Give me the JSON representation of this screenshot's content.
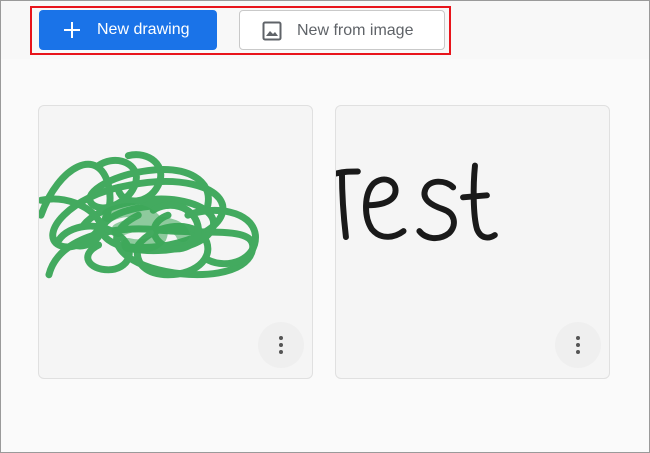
{
  "toolbar": {
    "new_drawing_label": "New drawing",
    "new_from_image_label": "New from image"
  },
  "gallery": {
    "cards": [
      {
        "id": "green-scribble",
        "ink_color": "#3aa757"
      },
      {
        "id": "test-text",
        "ink_color": "#1a1a1a"
      }
    ]
  },
  "colors": {
    "primary": "#1a73e8",
    "highlight_outline": "#e8141b"
  }
}
